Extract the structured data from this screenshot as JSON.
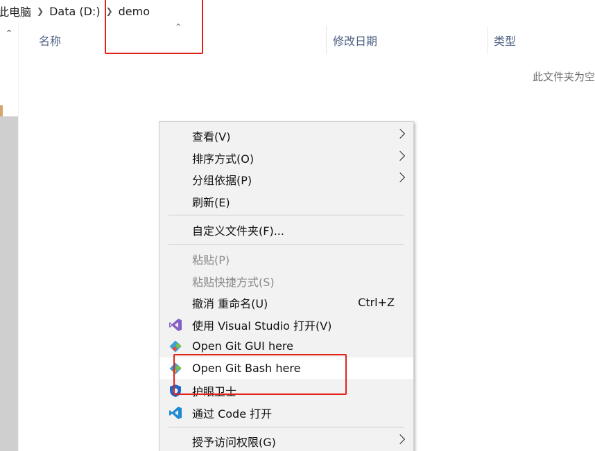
{
  "breadcrumb": {
    "items": [
      "此电脑",
      "Data (D:)",
      "demo"
    ]
  },
  "columns": {
    "name": "名称",
    "date": "修改日期",
    "type": "类型"
  },
  "empty_text": "此文件夹为空",
  "context_menu": {
    "items": [
      {
        "label": "查看(V)",
        "submenu": true
      },
      {
        "label": "排序方式(O)",
        "submenu": true
      },
      {
        "label": "分组依据(P)",
        "submenu": true
      },
      {
        "label": "刷新(E)"
      },
      {
        "label": "自定义文件夹(F)..."
      },
      {
        "label": "粘贴(P)",
        "disabled": true
      },
      {
        "label": "粘贴快捷方式(S)",
        "disabled": true
      },
      {
        "label": "撤消 重命名(U)",
        "shortcut": "Ctrl+Z"
      },
      {
        "label": "使用 Visual Studio 打开(V)",
        "icon": "visual-studio-icon"
      },
      {
        "label": "Open Git GUI here",
        "icon": "git-gui-icon"
      },
      {
        "label": "Open Git Bash here",
        "icon": "git-bash-icon",
        "highlighted": true
      },
      {
        "label": "护眼卫士",
        "icon": "shield-icon"
      },
      {
        "label": "通过 Code 打开",
        "icon": "vscode-icon"
      },
      {
        "label": "授予访问权限(G)",
        "submenu": true
      }
    ]
  },
  "colors": {
    "highlight_box": "#e2231a",
    "menu_bg": "#f2f2f2",
    "column_header": "#4d6082"
  }
}
